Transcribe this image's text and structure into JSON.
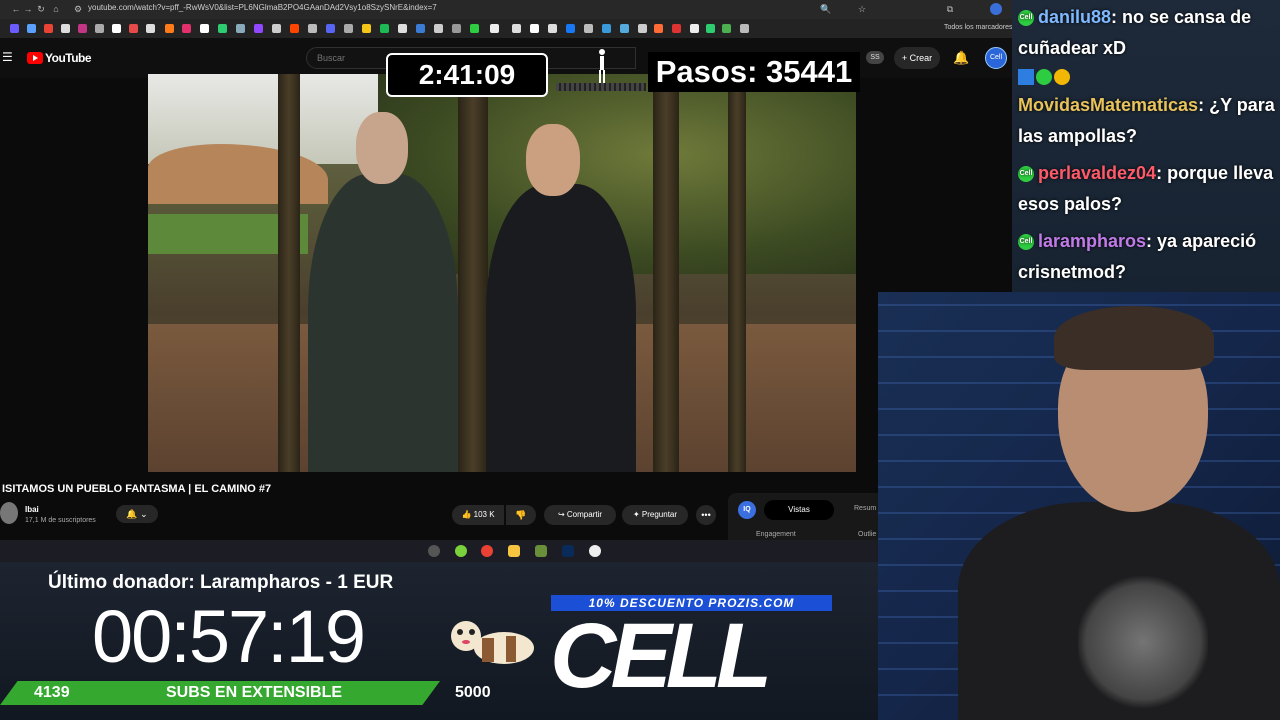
{
  "browser": {
    "url": "youtube.com/watch?v=pff_-RwWsV0&list=PL6NGlmaB2PO4GAanDAd2Vsy1o8SzySNrE&index=7",
    "bookmarks_label": "Todos los marcadores"
  },
  "youtube": {
    "brand": "YouTube",
    "search_placeholder": "Buscar",
    "ss_badge": "SS",
    "create_label": "Crear",
    "video_title": "ISITAMOS UN PUEBLO FANTASMA | EL CAMINO #7",
    "channel_name": "Ibai",
    "channel_subs": "17,1 M de suscriptores",
    "like_count": "103 K",
    "share_label": "Compartir",
    "ask_label": "Preguntar",
    "more_label": "•••",
    "panel": {
      "iq_label": "IQ",
      "tab_vistas": "Vistas",
      "tab_resumen": "Resum",
      "engagement_label": "Engagement",
      "outlier_label": "Outlie"
    }
  },
  "overlay": {
    "timer_top": "2:41:09",
    "steps_text": "Pasos: 35441",
    "last_donor": "Último donador: Larampharos - 1 EUR",
    "countdown": "00:57:19",
    "promo": "10% DESCUENTO PROZIS.COM",
    "cell_logo": "CELL",
    "subs_current": "4139",
    "subs_label": "SUBS EN EXTENSIBLE",
    "subs_goal": "5000"
  },
  "chat": {
    "messages": [
      {
        "user": "danilu88",
        "user_color": "#7fb8ff",
        "text": ": no se cansa de cuñadear xD"
      },
      {
        "user": "MovidasMatematicas",
        "user_color": "#e8c25a",
        "text": ": ¿Y para las ampollas?"
      },
      {
        "user": "perlavaldez04",
        "user_color": "#ff5a6a",
        "text": ": porque lleva esos palos?"
      },
      {
        "user": "larampharos",
        "user_color": "#c07be8",
        "text": ": ya apareció crisnetmod?"
      }
    ],
    "badge_text": "Cell"
  },
  "colors": {
    "yt_red": "#ff0000",
    "subs_green": "#35a830",
    "promo_blue": "#1a4fd6"
  }
}
